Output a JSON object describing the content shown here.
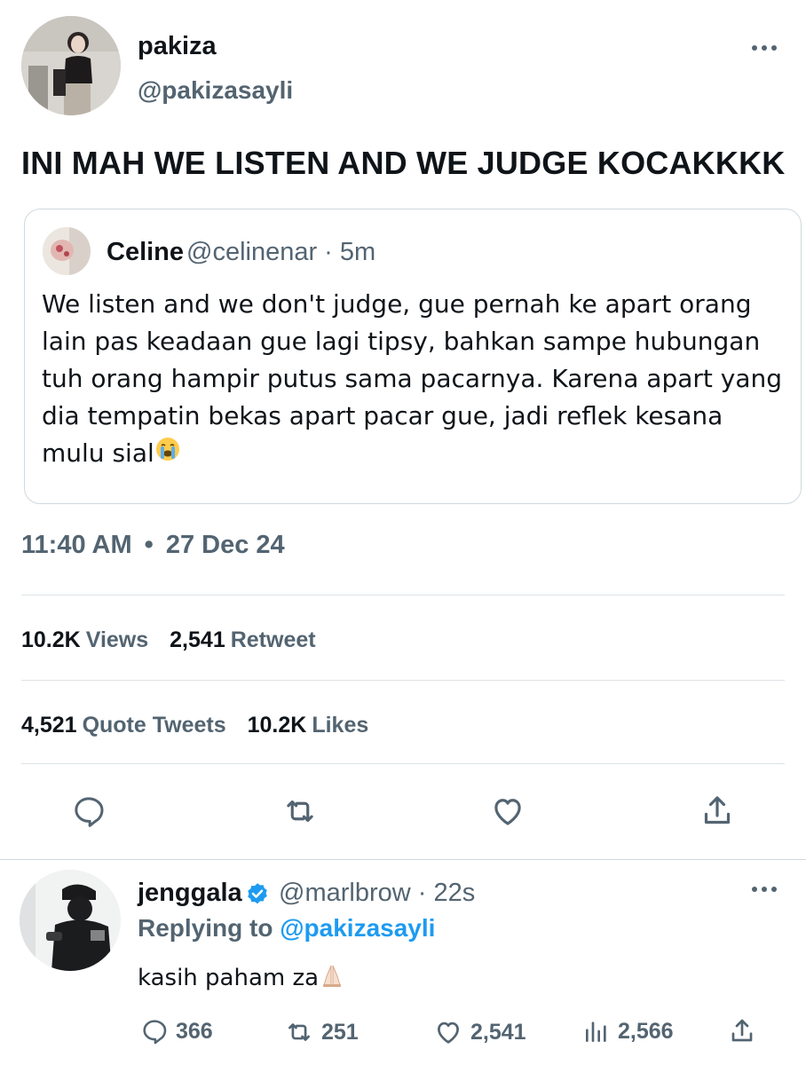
{
  "main_tweet": {
    "display_name": "pakiza",
    "handle": "@pakizasayli",
    "text": "INI MAH WE LISTEN AND WE JUDGE KOCAKKKK",
    "timestamp_time": "11:40 AM",
    "timestamp_dot": "•",
    "timestamp_date": "27 Dec 24",
    "views_count": "10.2K",
    "views_label": "Views",
    "retweets_count": "2,541",
    "retweets_label": "Retweet",
    "quotes_count": "4,521",
    "quotes_label": "Quote Tweets",
    "likes_count": "10.2K",
    "likes_label": "Likes"
  },
  "quoted_tweet": {
    "display_name": "Celine",
    "handle_time": "@celinenar · 5m",
    "body": "We listen and we don't judge, gue pernah ke apart orang lain pas keadaan gue lagi tipsy, bahkan sampe hubungan tuh orang hampir putus sama pacarnya. Karena apart yang dia tempatin bekas apart pacar gue, jadi reflek kesana mulu sial",
    "emoji": "loudly-crying-face"
  },
  "reply": {
    "display_name": "jenggala",
    "verified_icon": "verified-badge-icon",
    "handle_time": "@marlbrow · 22s",
    "replying_prefix": "Replying to",
    "replying_mention": "@pakizasayli",
    "text": "kasih paham za",
    "emoji": "folded-hands",
    "reply_count": "366",
    "retweet_count": "251",
    "like_count": "2,541",
    "view_count": "2,566"
  },
  "colors": {
    "text_primary": "#0f1419",
    "text_secondary": "#536471",
    "accent": "#1d9bf0",
    "divider": "#dde3e6"
  }
}
